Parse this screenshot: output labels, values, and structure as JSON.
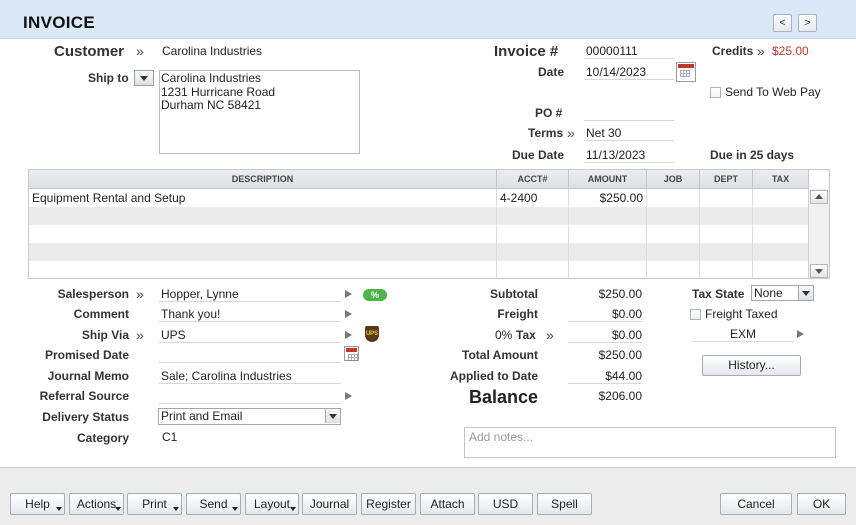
{
  "header": {
    "title": "INVOICE",
    "prev": "<",
    "next": ">"
  },
  "customer": {
    "label": "Customer",
    "value": "Carolina Industries"
  },
  "ship_to": {
    "label": "Ship to",
    "lines": [
      "Carolina Industries",
      "1231 Hurricane Road",
      "Durham NC 58421"
    ]
  },
  "invoice": {
    "number_label": "Invoice #",
    "number": "00000111",
    "credits_label": "Credits",
    "credits_value": "$25.00",
    "date_label": "Date",
    "date": "10/14/2023",
    "send_web_pay": "Send To Web Pay",
    "po_label": "PO #",
    "po": "",
    "terms_label": "Terms",
    "terms": "Net 30",
    "due_label": "Due Date",
    "due": "11/13/2023",
    "due_note": "Due in 25 days"
  },
  "grid": {
    "columns": [
      "DESCRIPTION",
      "ACCT#",
      "AMOUNT",
      "JOB",
      "DEPT",
      "TAX"
    ],
    "rows": [
      [
        "Equipment Rental and Setup",
        "4-2400",
        "$250.00",
        "",
        "",
        ""
      ]
    ]
  },
  "details": {
    "salesperson_label": "Salesperson",
    "salesperson": "Hopper, Lynne",
    "comment_label": "Comment",
    "comment": "Thank you!",
    "ship_via_label": "Ship Via",
    "ship_via": "UPS",
    "promised_label": "Promised Date",
    "promised": "",
    "journal_memo_label": "Journal Memo",
    "journal_memo": "Sale; Carolina Industries",
    "referral_label": "Referral Source",
    "referral": "",
    "delivery_label": "Delivery Status",
    "delivery": "Print and Email",
    "category_label": "Category",
    "category": "C1",
    "pct_badge": "%",
    "ups_badge": "UPS"
  },
  "totals": {
    "subtotal_label": "Subtotal",
    "subtotal": "$250.00",
    "freight_label": "Freight",
    "freight": "$0.00",
    "tax_pct": "0%",
    "tax_label": "Tax",
    "tax": "$0.00",
    "total_label": "Total Amount",
    "total": "$250.00",
    "applied_label": "Applied to Date",
    "applied": "$44.00",
    "balance_label": "Balance",
    "balance": "$206.00"
  },
  "tax_panel": {
    "state_label": "Tax State",
    "state": "None",
    "freight_taxed": "Freight Taxed",
    "code": "EXM",
    "history": "History..."
  },
  "notes_placeholder": "Add notes...",
  "footer": {
    "buttons": [
      "Help",
      "Actions",
      "Print",
      "Send",
      "Layout",
      "Journal",
      "Register",
      "Attach",
      "USD",
      "Spell"
    ],
    "cancel": "Cancel",
    "ok": "OK"
  },
  "colors": {
    "header_bg": "#dbe8f7",
    "credit_red": "#c0392b",
    "badge_green": "#4db34a"
  }
}
